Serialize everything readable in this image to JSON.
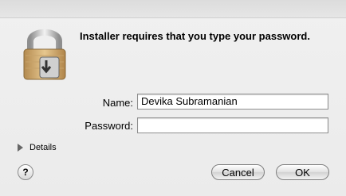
{
  "dialog": {
    "message": "Installer requires that you type your password.",
    "name_label": "Name:",
    "name_value": "Devika Subramanian",
    "password_label": "Password:",
    "password_value": "",
    "details_label": "Details",
    "help_label": "?",
    "cancel_label": "Cancel",
    "ok_label": "OK",
    "lock_icon": "padlock-with-install-icon"
  }
}
